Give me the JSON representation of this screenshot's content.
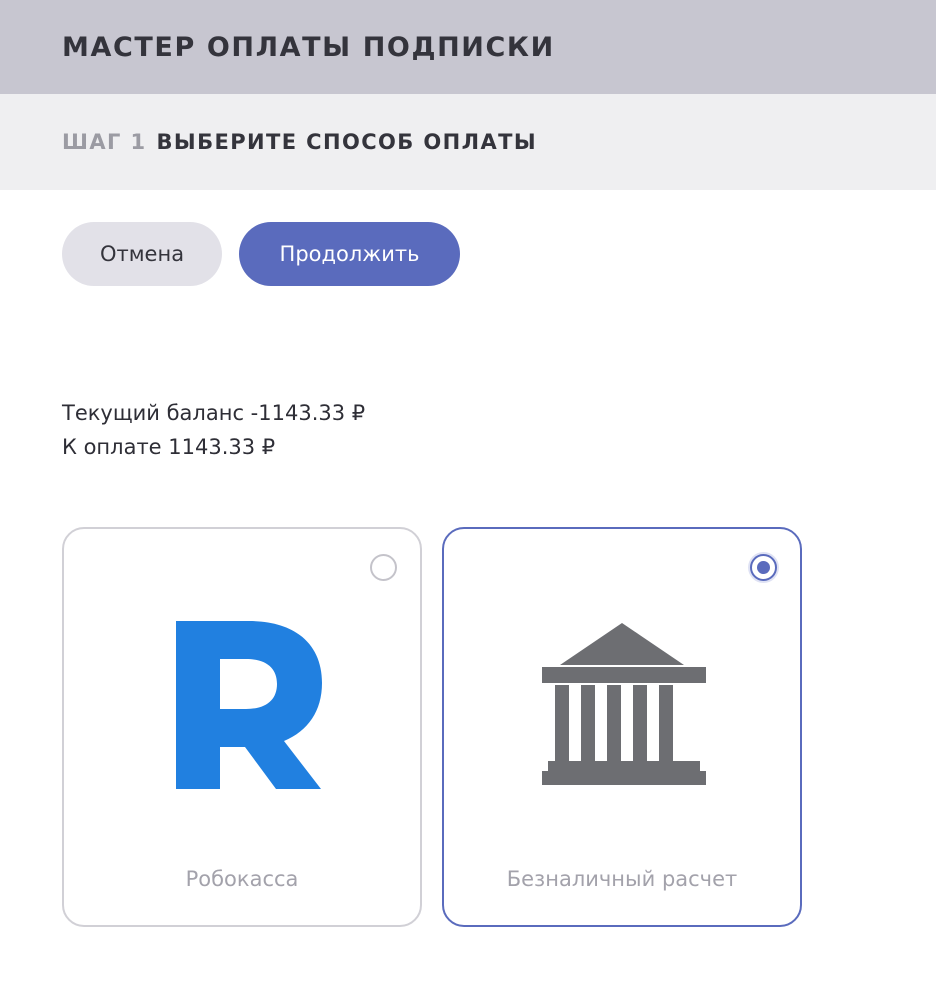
{
  "wizard": {
    "title": "МАСТЕР ОПЛАТЫ ПОДПИСКИ"
  },
  "step": {
    "number": "ШАГ 1",
    "title": "ВЫБЕРИТЕ СПОСОБ ОПЛАТЫ"
  },
  "actions": {
    "cancel_label": "Отмена",
    "continue_label": "Продолжить"
  },
  "balance": {
    "current_line": "Текущий баланс -1143.33 ₽",
    "due_line": "К оплате 1143.33 ₽"
  },
  "payment_methods": [
    {
      "label": "Робокасса",
      "icon": "robokassa-logo",
      "selected": false
    },
    {
      "label": "Безналичный расчет",
      "icon": "bank-building-icon",
      "selected": true
    }
  ],
  "colors": {
    "accent": "#5a6bbd",
    "robokassa_brand": "#2180e0",
    "bank_icon": "#6d6e72"
  }
}
